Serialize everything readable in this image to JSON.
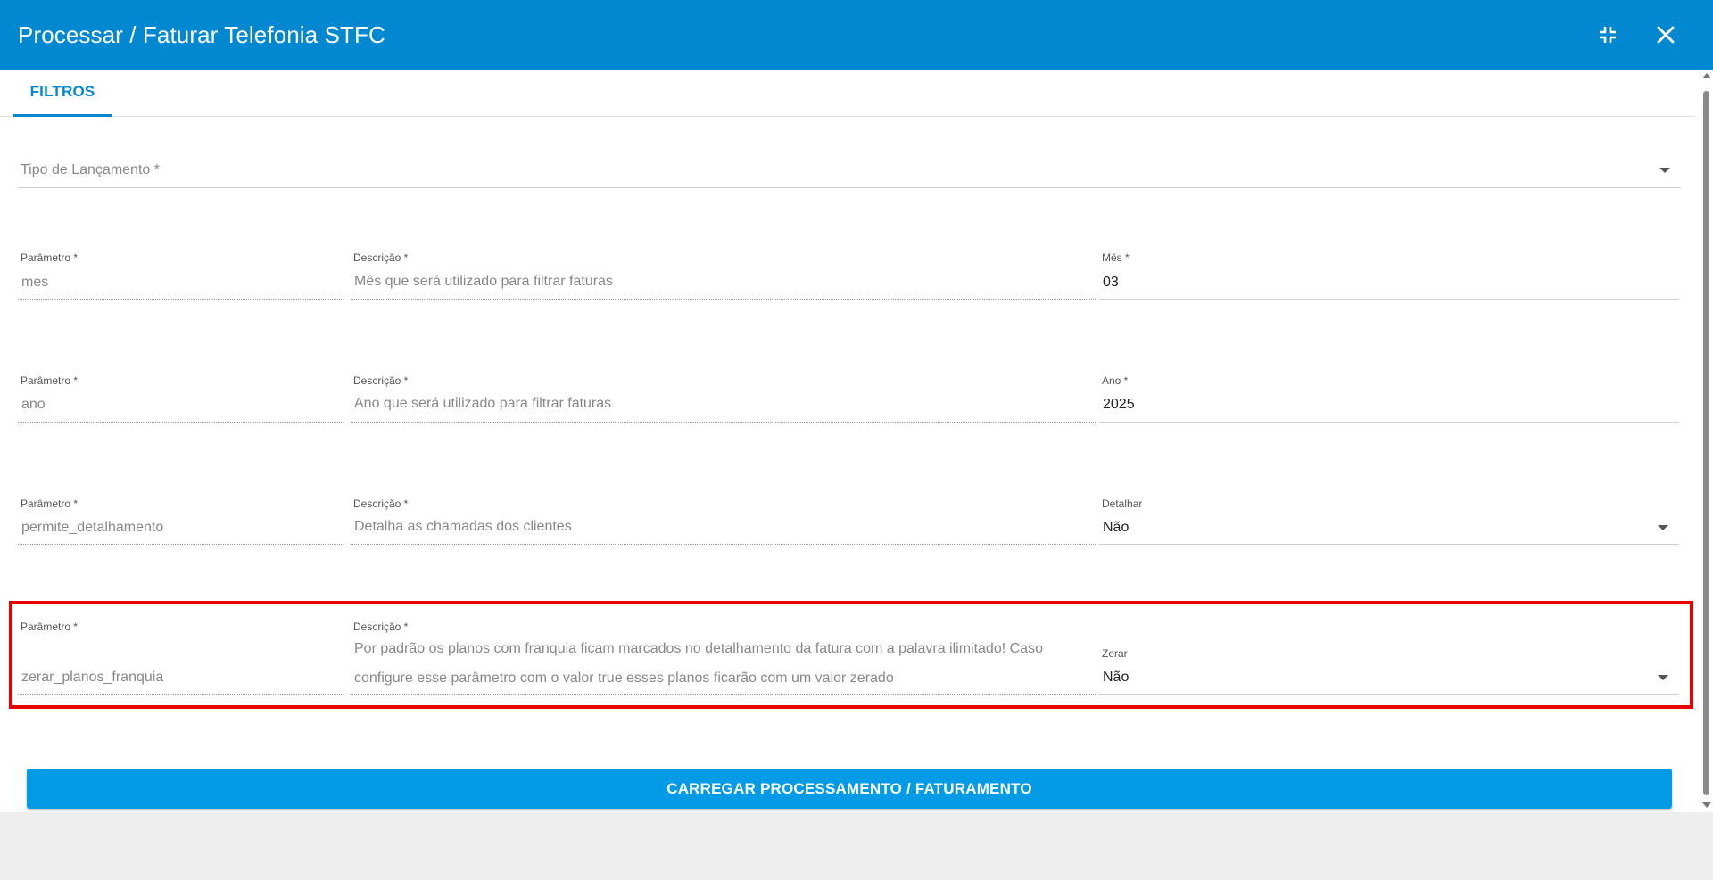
{
  "header": {
    "title": "Processar / Faturar Telefonia STFC"
  },
  "tabs": [
    {
      "label": "FILTROS"
    }
  ],
  "tipo_lancamento": {
    "placeholder": "Tipo de Lançamento *"
  },
  "rows": [
    {
      "param_label": "Parâmetro *",
      "param_value": "mes",
      "desc_label": "Descrição *",
      "desc_value": "Mês que será utilizado para filtrar faturas",
      "value_label": "Mês *",
      "value": "03"
    },
    {
      "param_label": "Parâmetro *",
      "param_value": "ano",
      "desc_label": "Descrição *",
      "desc_value": "Ano que será utilizado para filtrar faturas",
      "value_label": "Ano *",
      "value": "2025"
    },
    {
      "param_label": "Parâmetro *",
      "param_value": "permite_detalhamento",
      "desc_label": "Descrição *",
      "desc_value": "Detalha as chamadas dos clientes",
      "value_label": "Detalhar",
      "value": "Não"
    },
    {
      "param_label": "Parâmetro *",
      "param_value": "zerar_planos_franquia",
      "desc_label": "Descrição *",
      "desc_line1": "Por padrão os planos com franquia ficam marcados no detalhamento da fatura com a palavra ilimitado! Caso",
      "desc_line2": "configure esse parâmetro com o valor true esses planos ficarão com um valor zerado",
      "value_label": "Zerar",
      "value": "Não"
    }
  ],
  "action": {
    "label": "CARREGAR PROCESSAMENTO / FATURAMENTO"
  },
  "colors": {
    "primary": "#0288d1",
    "button": "#039be5",
    "highlight": "#e60000"
  },
  "icons": {
    "minimize": "collapse-icon",
    "close": "close-icon"
  }
}
